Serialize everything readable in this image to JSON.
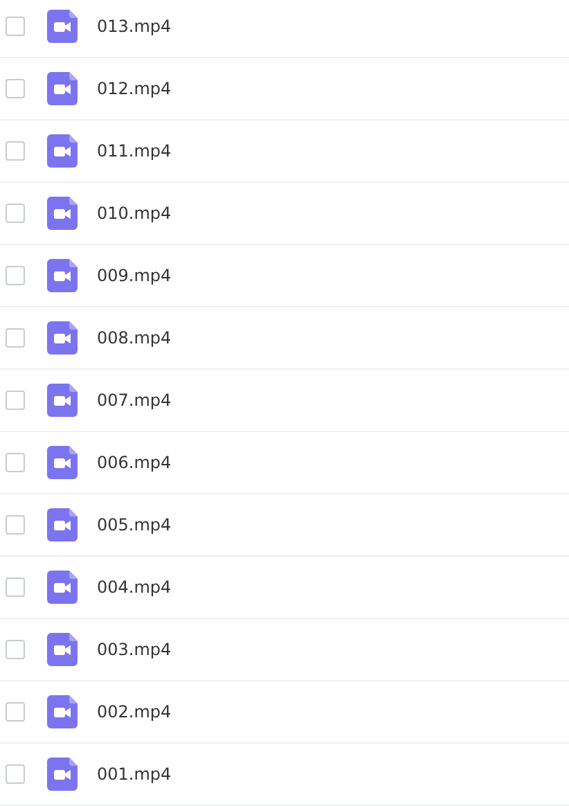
{
  "files": [
    {
      "name": "013.mp4",
      "checked": false
    },
    {
      "name": "012.mp4",
      "checked": false
    },
    {
      "name": "011.mp4",
      "checked": false
    },
    {
      "name": "010.mp4",
      "checked": false
    },
    {
      "name": "009.mp4",
      "checked": false
    },
    {
      "name": "008.mp4",
      "checked": false
    },
    {
      "name": "007.mp4",
      "checked": false
    },
    {
      "name": "006.mp4",
      "checked": false
    },
    {
      "name": "005.mp4",
      "checked": false
    },
    {
      "name": "004.mp4",
      "checked": false
    },
    {
      "name": "003.mp4",
      "checked": false
    },
    {
      "name": "002.mp4",
      "checked": false
    },
    {
      "name": "001.mp4",
      "checked": false
    }
  ]
}
